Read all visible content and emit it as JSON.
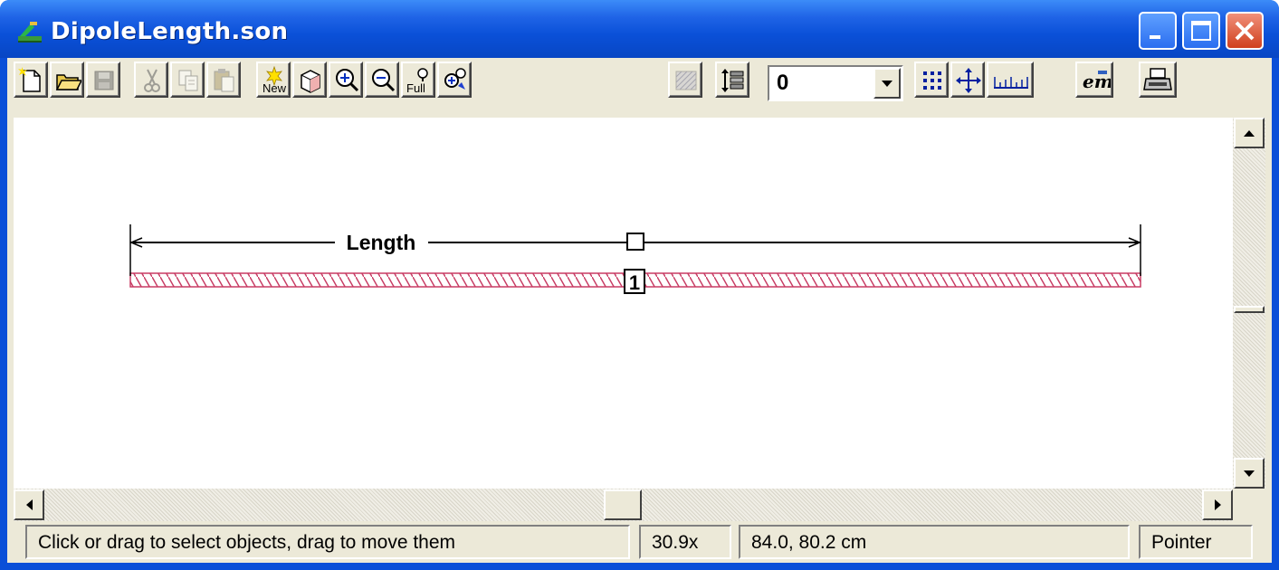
{
  "window": {
    "title": "DipoleLength.son"
  },
  "toolbar": {
    "layer_value": "0",
    "buttons": [
      {
        "name": "new-file",
        "icon": "new-file-icon"
      },
      {
        "name": "open",
        "icon": "open-folder-icon"
      },
      {
        "name": "save",
        "icon": "save-disk-icon"
      },
      {
        "name": "cut",
        "icon": "scissors-icon"
      },
      {
        "name": "copy",
        "icon": "copy-icon"
      },
      {
        "name": "paste",
        "icon": "paste-icon"
      },
      {
        "name": "new-object",
        "icon": "new-star-icon",
        "label": "New"
      },
      {
        "name": "3d-view",
        "icon": "3d-box-icon"
      },
      {
        "name": "zoom-in",
        "icon": "zoom-in-icon"
      },
      {
        "name": "zoom-out",
        "icon": "zoom-out-icon"
      },
      {
        "name": "zoom-full",
        "icon": "zoom-full-icon",
        "label": "Full"
      },
      {
        "name": "zoom-box",
        "icon": "zoom-box-icon"
      },
      {
        "name": "metal-layer",
        "icon": "metal-pattern-icon"
      },
      {
        "name": "stackup",
        "icon": "layers-stack-icon"
      },
      {
        "name": "grid",
        "icon": "grid-dots-icon"
      },
      {
        "name": "move",
        "icon": "move-arrows-icon"
      },
      {
        "name": "ruler",
        "icon": "ruler-icon"
      },
      {
        "name": "em-analyze",
        "icon": "em-icon",
        "label": "em"
      },
      {
        "name": "print",
        "icon": "printer-icon"
      }
    ]
  },
  "canvas": {
    "dimension_label": "Length",
    "port_label": "1"
  },
  "status": {
    "message": "Click or drag to select objects, drag to move them",
    "zoom": "30.9x",
    "coords": "84.0, 80.2 cm",
    "mode": "Pointer"
  },
  "colors": {
    "titlebar": "#0a50d8",
    "chrome": "#ece9d8",
    "metal_hatch": "#c83c64",
    "close_button": "#d0401e"
  }
}
